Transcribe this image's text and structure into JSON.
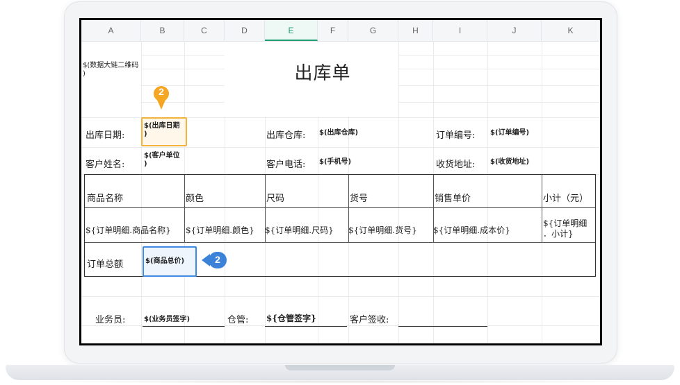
{
  "columns": [
    "A",
    "B",
    "C",
    "D",
    "E",
    "F",
    "G",
    "H",
    "I",
    "J",
    "K"
  ],
  "active_column": "E",
  "qr_placeholder": [
    "$(数据大链二维码",
    ")"
  ],
  "title": "出库单",
  "info_rows": {
    "row1": {
      "date_label": "出库日期:",
      "date_value": [
        "$(出库日期",
        ")"
      ],
      "warehouse_label": "出库仓库:",
      "warehouse_value": "$(出库仓库)",
      "order_no_label": "订单编号:",
      "order_no_value": "$(订单编号)"
    },
    "row2": {
      "customer_label": "客户姓名:",
      "customer_value": [
        "$(客户单位",
        ")"
      ],
      "phone_label": "客户电话:",
      "phone_value": "$(手机号)",
      "address_label": "收货地址:",
      "address_value": "$(收货地址)"
    }
  },
  "table": {
    "headers": [
      "商品名称",
      "颜色",
      "尺码",
      "货号",
      "销售单价",
      "小计（元）"
    ],
    "row": [
      "${订单明细.商品名称}",
      "${订单明细.颜色}",
      "${订单明细.尺码}",
      "${订单明细.货号}",
      "${订单明细.成本价}",
      "${订单明细",
      "．小计}"
    ],
    "total_label": "订单总额",
    "total_value": "$(商品总价)"
  },
  "footer": {
    "salesman_label": "业务员:",
    "salesman_value": "$(业务员签字)",
    "warehouse_label": "仓管:",
    "warehouse_value": "${仓管签字}",
    "customer_label": "客户签收:"
  },
  "markers": {
    "orange_pin": "2",
    "blue_tag": "2"
  },
  "colors": {
    "orange": "#f5a623",
    "blue": "#3b82d8",
    "active_col": "#1f9d73"
  }
}
